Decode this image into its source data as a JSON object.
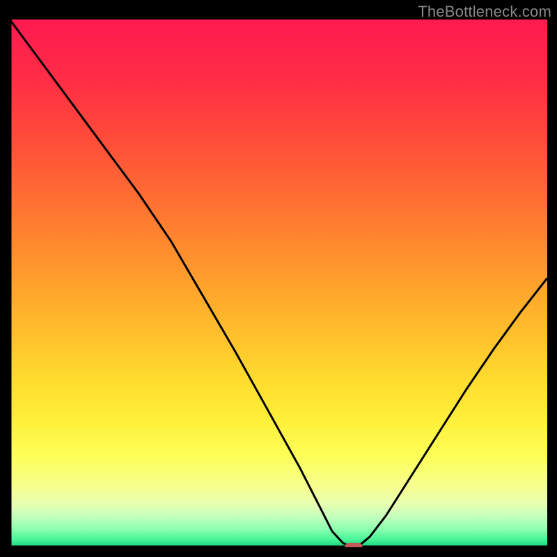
{
  "watermark": "TheBottleneck.com",
  "chart_data": {
    "type": "line",
    "title": "",
    "xlabel": "",
    "ylabel": "",
    "xlim": [
      0,
      100
    ],
    "ylim": [
      0,
      100
    ],
    "x": [
      0,
      8,
      16,
      24,
      30,
      36,
      42,
      48,
      54,
      58,
      60,
      62,
      63,
      64,
      65,
      67,
      70,
      75,
      80,
      85,
      90,
      95,
      100
    ],
    "values": [
      100,
      89,
      78,
      67,
      58,
      47.5,
      37,
      26,
      15,
      7,
      3,
      0.8,
      0.3,
      0.3,
      0.3,
      2,
      6,
      14,
      22,
      30,
      37.5,
      44.5,
      51
    ],
    "series_name": "bottleneck-curve",
    "marker": {
      "x": 64,
      "y": 0,
      "color": "#c35a5a",
      "width_pct": 3.2,
      "height_pct": 1.4
    },
    "gradient_stops": [
      {
        "offset": 0,
        "color": "#ff1a4f"
      },
      {
        "offset": 0.1,
        "color": "#ff2a47"
      },
      {
        "offset": 0.22,
        "color": "#ff4a3a"
      },
      {
        "offset": 0.34,
        "color": "#ff6e32"
      },
      {
        "offset": 0.46,
        "color": "#ff942d"
      },
      {
        "offset": 0.58,
        "color": "#ffbb2b"
      },
      {
        "offset": 0.68,
        "color": "#ffdb2e"
      },
      {
        "offset": 0.76,
        "color": "#fff03a"
      },
      {
        "offset": 0.83,
        "color": "#fdff5a"
      },
      {
        "offset": 0.885,
        "color": "#f6ff8e"
      },
      {
        "offset": 0.915,
        "color": "#eaffae"
      },
      {
        "offset": 0.94,
        "color": "#c8ffbf"
      },
      {
        "offset": 0.965,
        "color": "#8effb0"
      },
      {
        "offset": 0.985,
        "color": "#48f598"
      },
      {
        "offset": 1.0,
        "color": "#17d07a"
      }
    ],
    "axis_color": "#000000",
    "curve_color": "#000000",
    "curve_width": 3
  }
}
